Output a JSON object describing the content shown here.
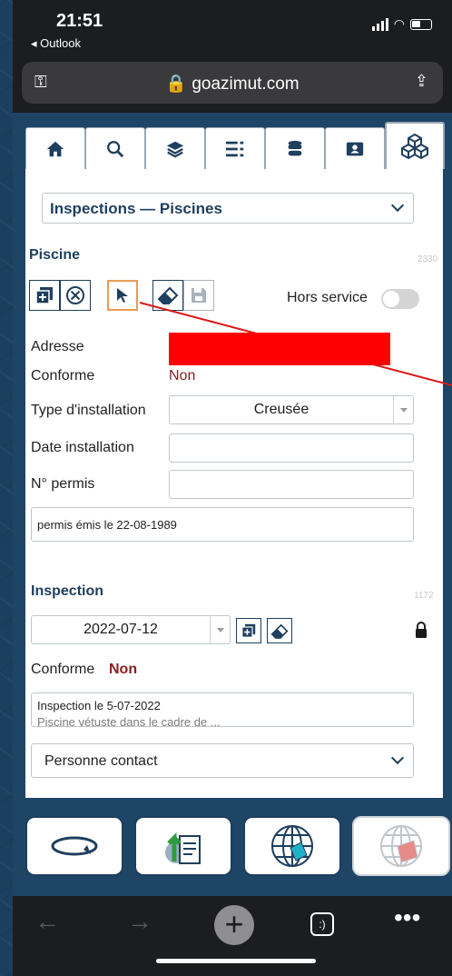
{
  "status_bar": {
    "time": "21:51",
    "back_app": "◂ Outlook"
  },
  "browser": {
    "url": "🔒 goazimut.com"
  },
  "tabs": [
    {
      "name": "home-icon"
    },
    {
      "name": "search-icon"
    },
    {
      "name": "layers-icon"
    },
    {
      "name": "list-icon"
    },
    {
      "name": "database-icon"
    },
    {
      "name": "contact-folder-icon"
    },
    {
      "name": "cubes-icon"
    }
  ],
  "module_select": {
    "value": "Inspections — Piscines"
  },
  "piscine": {
    "title": "Piscine",
    "id_label": "2330",
    "hors_service_label": "Hors service",
    "adresse_label": "Adresse",
    "conforme_label": "Conforme",
    "conforme_value": "Non",
    "type_label": "Type d'installation",
    "type_value": "Creusée",
    "date_label": "Date installation",
    "date_value": "",
    "permis_label": "N° permis",
    "permis_value": "",
    "note": "permis émis le 22-08-1989"
  },
  "inspection": {
    "title": "Inspection",
    "id_label": "1172",
    "date_value": "2022-07-12",
    "conforme_label": "Conforme",
    "conforme_value": "Non",
    "note_line1": "Inspection le 5-07-2022",
    "note_line2": "Piscine vétuste dans le cadre de ...",
    "contact_select": "Personne contact"
  },
  "colors": {
    "primary": "#1e3f5e",
    "negative": "#8b1e1e",
    "selected_border": "#e89b55",
    "redaction": "#ff0000"
  }
}
